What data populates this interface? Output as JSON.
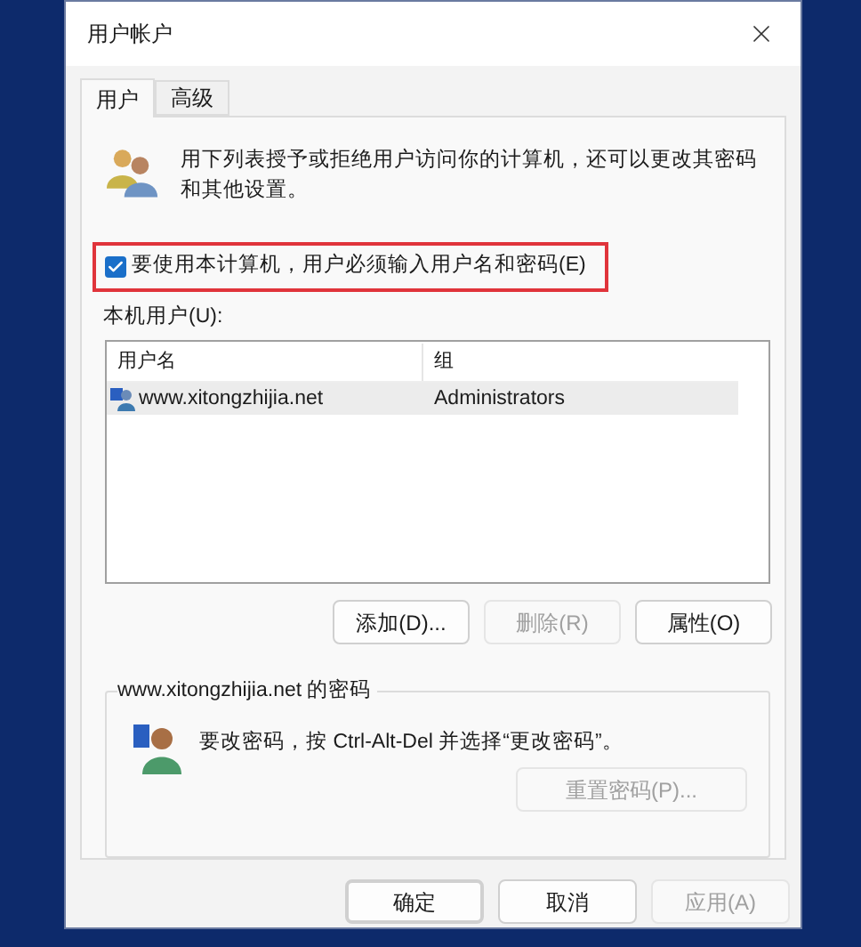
{
  "window": {
    "title": "用户帐户"
  },
  "tabs": [
    {
      "label": "用户",
      "selected": true
    },
    {
      "label": "高级",
      "selected": false
    }
  ],
  "intro": "用下列表授予或拒绝用户访问你的计算机，还可以更改其密码和其他设置。",
  "require_password": {
    "label": "要使用本计算机，用户必须输入用户名和密码(E)",
    "checked": true,
    "highlighted": true
  },
  "users_label": "本机用户(U):",
  "users_table": {
    "columns": [
      "用户名",
      "组"
    ],
    "rows": [
      {
        "name": "www.xitongzhijia.net",
        "group": "Administrators",
        "selected": true
      }
    ]
  },
  "user_buttons": [
    {
      "label": "添加(D)...",
      "disabled": false
    },
    {
      "label": "删除(R)",
      "disabled": true
    },
    {
      "label": "属性(O)",
      "disabled": false
    }
  ],
  "password_group": {
    "title": "www.xitongzhijia.net 的密码",
    "message": "要改密码，按 Ctrl-Alt-Del 并选择“更改密码”。",
    "button": {
      "label": "重置密码(P)...",
      "disabled": true
    }
  },
  "dialog_buttons": [
    {
      "label": "确定",
      "disabled": false,
      "default": true
    },
    {
      "label": "取消",
      "disabled": false,
      "default": false
    },
    {
      "label": "应用(A)",
      "disabled": true,
      "default": false
    }
  ]
}
